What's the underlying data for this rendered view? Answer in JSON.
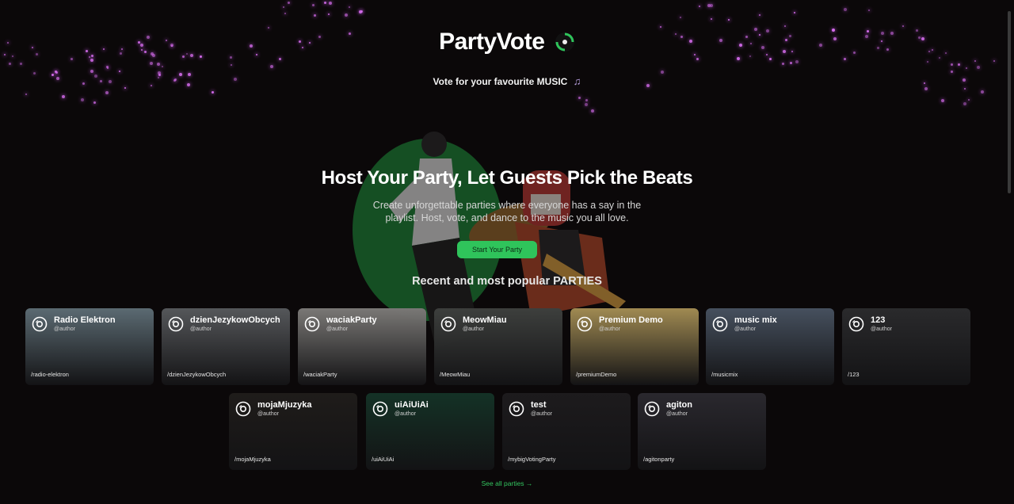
{
  "header": {
    "brand": "PartyVote",
    "tagline": "Vote for your favourite MUSIC"
  },
  "hero": {
    "title": "Host Your Party, Let Guests Pick the Beats",
    "description": "Create unforgettable parties where everyone has a say in the playlist. Host, vote, and dance to the music you all love.",
    "cta_label": "Start Your Party"
  },
  "section": {
    "title": "Recent and most popular PARTIES"
  },
  "parties": [
    {
      "name": "Radio Elektron",
      "author": "@author",
      "slug": "/radio-elektron",
      "bg": "#5b6a72"
    },
    {
      "name": "dzienJezykowObcych",
      "author": "@author",
      "slug": "/dzienJezykowObcych",
      "bg": "#55575a"
    },
    {
      "name": "waciakParty",
      "author": "@author",
      "slug": "/waciakParty",
      "bg": "#7a7876"
    },
    {
      "name": "MeowMiau",
      "author": "@author",
      "slug": "/MeowMiau",
      "bg": "#3d3f3d"
    },
    {
      "name": "Premium Demo",
      "author": "@author",
      "slug": "/premiumDemo",
      "bg": "#a08a52"
    },
    {
      "name": "music mix",
      "author": "@author",
      "slug": "/musicmix",
      "bg": "#46505e"
    },
    {
      "name": "123",
      "author": "@author",
      "slug": "/123",
      "bg": "#2a2a2c"
    },
    {
      "name": "mojaMjuzyka",
      "author": "@author",
      "slug": "/mojaMjuzyka",
      "bg": "#1f1c1a"
    },
    {
      "name": "uiAiUiAi",
      "author": "@author",
      "slug": "/uiAiUiAi",
      "bg": "#143226"
    },
    {
      "name": "test",
      "author": "@author",
      "slug": "/mybigVotingParty",
      "bg": "#1d1b1d"
    },
    {
      "name": "agiton",
      "author": "@author",
      "slug": "/agitonparty",
      "bg": "#2a282e"
    }
  ],
  "see_all_label": "See all parties →",
  "colors": {
    "accent": "#2fc45b",
    "background": "#0b0809",
    "stars": "#d86ef0"
  },
  "icons": {
    "brand": "vinyl-disc-icon",
    "tagline": "music-note-icon",
    "card": "vinyl-disc-icon"
  }
}
